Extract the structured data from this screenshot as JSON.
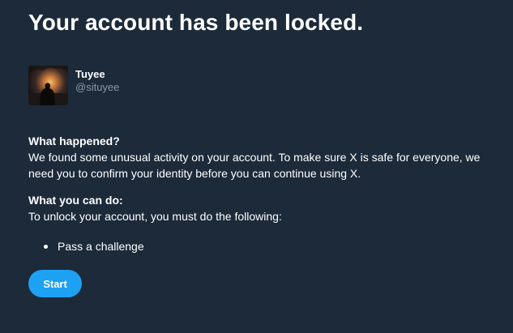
{
  "header": {
    "title": "Your account has been locked."
  },
  "user": {
    "name": "Tuyee",
    "handle": "@situyee"
  },
  "what_happened": {
    "heading": "What happened?",
    "body": "We found some unusual activity on your account. To make sure X is safe for everyone, we need you to confirm your identity before you can continue using X."
  },
  "what_you_can_do": {
    "heading": "What you can do:",
    "body": "To unlock your account, you must do the following:",
    "steps": [
      "Pass a challenge"
    ]
  },
  "actions": {
    "start_label": "Start"
  },
  "colors": {
    "background": "#1c2a3a",
    "text": "#ffffff",
    "muted_text": "#8899a6",
    "button": "#1da1f2"
  }
}
